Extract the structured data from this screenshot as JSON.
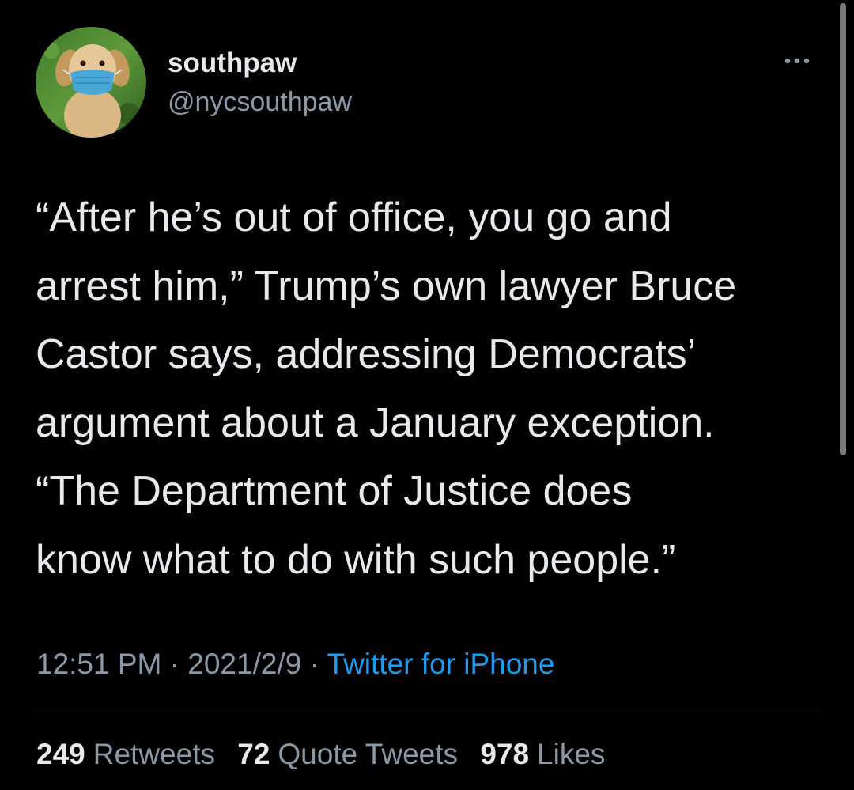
{
  "author": {
    "display_name": "southpaw",
    "handle": "@nycsouthpaw",
    "avatar_icon": "dog-with-mask-avatar"
  },
  "tweet": {
    "text_lines": [
      "“After he’s out of office, you go and",
      "arrest him,” Trump’s own lawyer Bruce",
      "Castor says, addressing Democrats’",
      "argument about a January exception.",
      "“The Department of Justice does",
      "know what to do with such people.”"
    ]
  },
  "meta": {
    "time": "12:51 PM",
    "separator": " · ",
    "date": "2021/2/9",
    "source": "Twitter for iPhone"
  },
  "stats": [
    {
      "count": "249",
      "label": "Retweets"
    },
    {
      "count": "72",
      "label": "Quote Tweets"
    },
    {
      "count": "978",
      "label": "Likes"
    }
  ],
  "colors": {
    "background": "#000000",
    "primary_text": "#e7e9ea",
    "secondary_text": "#8b98a5",
    "link": "#1d9bf0",
    "divider": "#2f3336"
  },
  "icons": {
    "more": "more-horizontal-icon"
  }
}
